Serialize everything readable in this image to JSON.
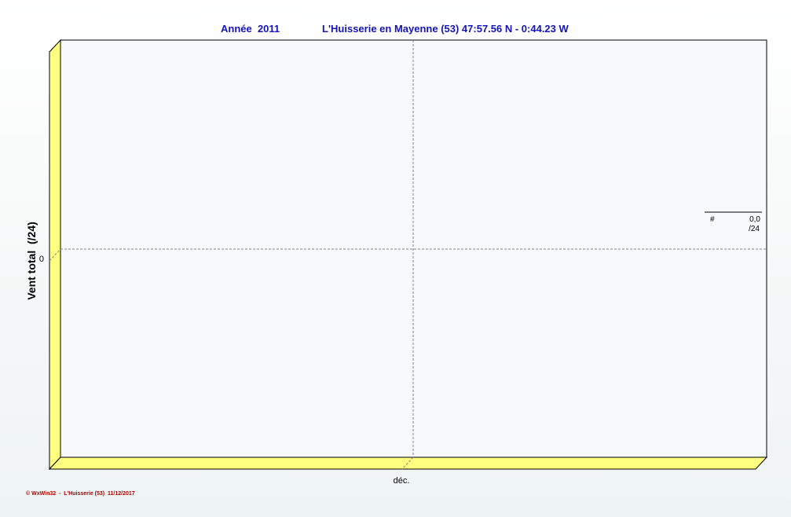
{
  "header": {
    "year_label": "Année  2011",
    "station_label": "L'Huisserie en Mayenne (53) 47:57.56 N - 0:44.23 W"
  },
  "colors": {
    "title": "#1414b4",
    "wall": "#ffff80",
    "grid": "#808080",
    "footer": "#b40000",
    "legend_line": "#000000"
  },
  "chart_data": {
    "type": "bar",
    "ylabel": "Vent total  (/24)",
    "xlabel": "",
    "categories": [
      "déc."
    ],
    "y_ticks": [
      0
    ],
    "series": [
      {
        "values": [
          0
        ]
      }
    ],
    "grid": true
  },
  "legend": {
    "symbol": "#",
    "value": "0,0",
    "unit": "/24"
  },
  "footer": {
    "credit": "© WxWin32  -  L'Huisserie (53)  11/12/2017"
  }
}
